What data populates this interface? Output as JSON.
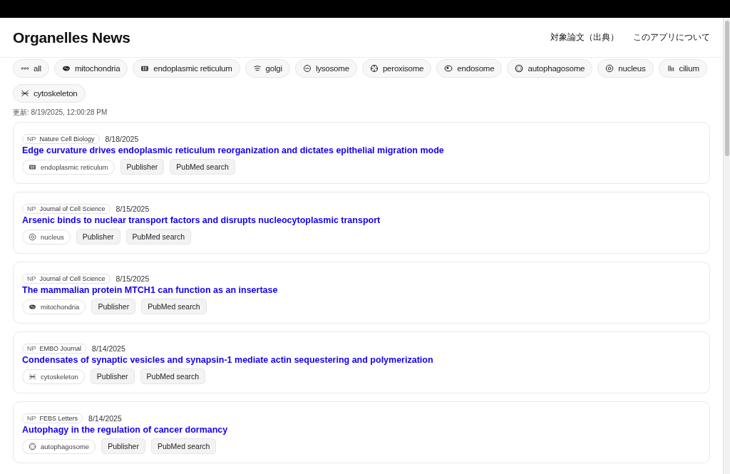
{
  "header": {
    "title": "Organelles News",
    "links": [
      "対象論文（出典）",
      "このアプリについて"
    ]
  },
  "filters": [
    {
      "label": "all",
      "kind": "all",
      "selected": false
    },
    {
      "label": "mitochondria",
      "kind": "mito",
      "selected": false
    },
    {
      "label": "endoplasmic reticulum",
      "kind": "er",
      "selected": false
    },
    {
      "label": "golgi",
      "kind": "golgi",
      "selected": false
    },
    {
      "label": "lysosome",
      "kind": "lyso",
      "selected": false
    },
    {
      "label": "peroxisome",
      "kind": "perox",
      "selected": false
    },
    {
      "label": "endosome",
      "kind": "endo",
      "selected": false
    },
    {
      "label": "autophagosome",
      "kind": "auto",
      "selected": false
    },
    {
      "label": "nucleus",
      "kind": "nucleus",
      "selected": false
    },
    {
      "label": "cilium",
      "kind": "cilium",
      "selected": false
    },
    {
      "label": "cytoskeleton",
      "kind": "cyto",
      "selected": false
    }
  ],
  "updated": "更新: 8/19/2025, 12:00:28 PM",
  "articles": [
    {
      "badge": "NP",
      "journal": "Nature Cell Biology",
      "date": "8/18/2025",
      "title": "Edge curvature drives endoplasmic reticulum reorganization and dictates epithelial migration mode",
      "tag": {
        "label": "endoplasmic reticulum",
        "kind": "er"
      },
      "buttons": [
        "Publisher",
        "PubMed search"
      ]
    },
    {
      "badge": "NP",
      "journal": "Journal of Cell Science",
      "date": "8/15/2025",
      "title": "Arsenic binds to nuclear transport factors and disrupts nucleocytoplasmic transport",
      "tag": {
        "label": "nucleus",
        "kind": "nucleus"
      },
      "buttons": [
        "Publisher",
        "PubMed search"
      ]
    },
    {
      "badge": "NP",
      "journal": "Journal of Cell Science",
      "date": "8/15/2025",
      "title": "The mammalian protein MTCH1 can function as an insertase",
      "tag": {
        "label": "mitochondria",
        "kind": "mito"
      },
      "buttons": [
        "Publisher",
        "PubMed search"
      ]
    },
    {
      "badge": "NP",
      "journal": "EMBO Journal",
      "date": "8/14/2025",
      "title": "Condensates of synaptic vesicles and synapsin-1 mediate actin sequestering and polymerization",
      "tag": {
        "label": "cytoskeleton",
        "kind": "cyto"
      },
      "buttons": [
        "Publisher",
        "PubMed search"
      ]
    },
    {
      "badge": "NP",
      "journal": "FEBS Letters",
      "date": "8/14/2025",
      "title": "Autophagy in the regulation of cancer dormancy",
      "tag": {
        "label": "autophagosome",
        "kind": "auto"
      },
      "buttons": [
        "Publisher",
        "PubMed search"
      ]
    }
  ]
}
